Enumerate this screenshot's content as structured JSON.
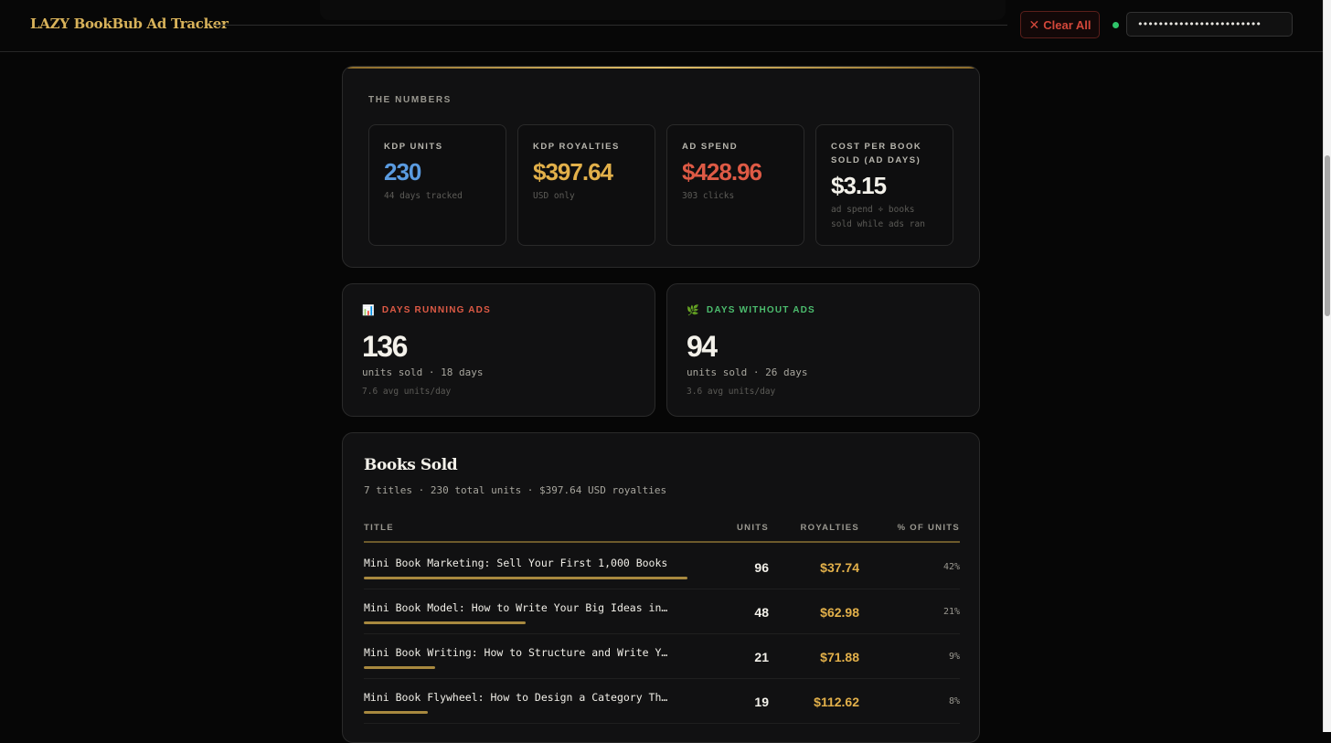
{
  "app": {
    "title": "LAZY BookBub Ad Tracker"
  },
  "header": {
    "clear_label": "Clear All",
    "api_key_value": "••••••••••••••••••••••••"
  },
  "numbers": {
    "section_label": "THE NUMBERS",
    "stats": [
      {
        "label": "KDP UNITS",
        "value": "230",
        "sub": "44 days tracked",
        "color": "#5a9be0"
      },
      {
        "label": "KDP ROYALTIES",
        "value": "$397.64",
        "sub": "USD only",
        "color": "#e2b04a"
      },
      {
        "label": "AD SPEND",
        "value": "$428.96",
        "sub": "303 clicks",
        "color": "#de5a45"
      },
      {
        "label": "COST PER BOOK SOLD (AD DAYS)",
        "value": "$3.15",
        "sub": "ad spend ÷ books sold while ads ran",
        "color": "#f3f1ea"
      }
    ]
  },
  "days": {
    "running": {
      "icon": "bar-chart-icon",
      "label": "DAYS RUNNING ADS",
      "color": "#de5a45",
      "value": "136",
      "units_text": "units sold · 18 days",
      "avg_text": "7.6 avg units/day"
    },
    "without": {
      "icon": "sprout-icon",
      "label": "DAYS WITHOUT ADS",
      "color": "#4cbd6e",
      "value": "94",
      "units_text": "units sold · 26 days",
      "avg_text": "3.6 avg units/day"
    }
  },
  "books": {
    "title": "Books Sold",
    "subtitle": "7 titles · 230 total units · $397.64 USD royalties",
    "columns": {
      "title": "TITLE",
      "units": "UNITS",
      "royalties": "ROYALTIES",
      "pct": "% OF UNITS"
    },
    "rows": [
      {
        "title": "Mini Book Marketing: Sell Your First 1,000 Books",
        "units": "96",
        "royalties": "$37.74",
        "pct": "42%",
        "share": 1.0
      },
      {
        "title": "Mini Book Model: How to Write Your Big Ideas in…",
        "units": "48",
        "royalties": "$62.98",
        "pct": "21%",
        "share": 0.5
      },
      {
        "title": "Mini Book Writing: How to Structure and Write Y…",
        "units": "21",
        "royalties": "$71.88",
        "pct": "9%",
        "share": 0.219
      },
      {
        "title": "Mini Book Flywheel: How to Design a Category Th…",
        "units": "19",
        "royalties": "$112.62",
        "pct": "8%",
        "share": 0.198
      }
    ]
  }
}
